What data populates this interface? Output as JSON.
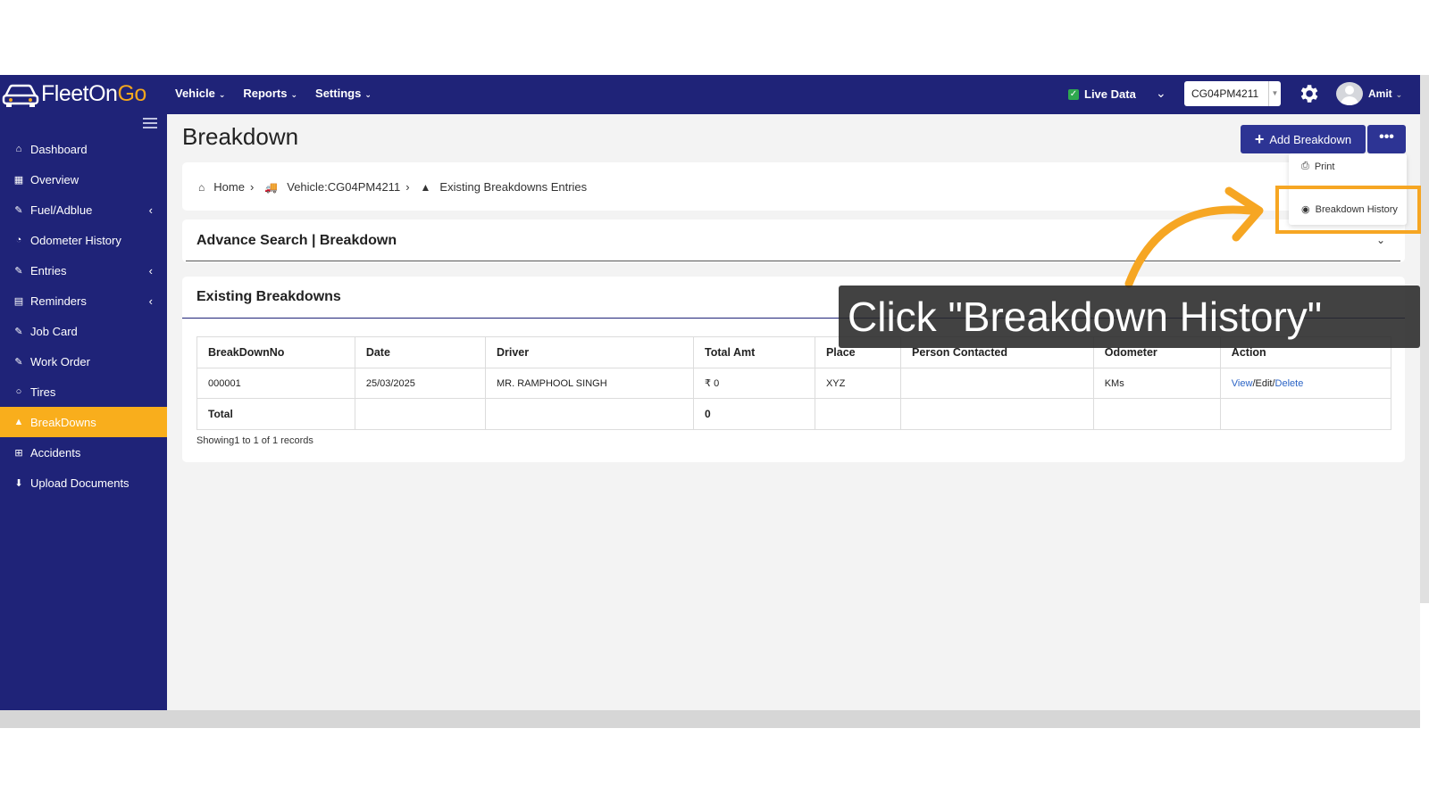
{
  "app": {
    "logo_fleet": "FleetOn",
    "logo_go": "Go",
    "nav": [
      {
        "label": "Vehicle"
      },
      {
        "label": "Reports"
      },
      {
        "label": "Settings"
      }
    ],
    "live_data_label": "Live Data",
    "vehicle_select": "CG04PM4211",
    "user_name": "Amit"
  },
  "sidebar": {
    "items": [
      {
        "label": "Dashboard",
        "icon": "home-icon",
        "glyph": "⌂",
        "top": 0
      },
      {
        "label": "Overview",
        "icon": "grid-icon",
        "glyph": "▦"
      },
      {
        "label": "Fuel/Adblue",
        "icon": "edit-icon",
        "glyph": "✎"
      },
      {
        "label": "Odometer History",
        "icon": "dashboard-icon",
        "glyph": "◔"
      },
      {
        "label": "Entries",
        "icon": "edit-icon",
        "glyph": "✎"
      },
      {
        "label": "Reminders",
        "icon": "calendar-icon",
        "glyph": "▤"
      },
      {
        "label": "Job Card",
        "icon": "edit-icon",
        "glyph": "✎"
      },
      {
        "label": "Work Order",
        "icon": "edit-icon",
        "glyph": "✎"
      },
      {
        "label": "Tires",
        "icon": "circle-icon",
        "glyph": "○"
      },
      {
        "label": "BreakDowns",
        "icon": "warning-icon",
        "glyph": "▲"
      },
      {
        "label": "Accidents",
        "icon": "plus-square-icon",
        "glyph": "⊞"
      },
      {
        "label": "Upload Documents",
        "icon": "download-icon",
        "glyph": "⬇"
      }
    ]
  },
  "page": {
    "title": "Breakdown",
    "add_button": "Add Breakdown",
    "more_button": "•••"
  },
  "dropdown": {
    "print": "Print",
    "breakdown_history": "Breakdown History"
  },
  "breadcrumb": {
    "home": "Home",
    "vehicle": "Vehicle:CG04PM4211",
    "current": "Existing Breakdowns Entries"
  },
  "advance_search": {
    "title": "Advance Search | Breakdown"
  },
  "existing": {
    "title": "Existing Breakdowns",
    "columns": [
      "BreakDownNo",
      "Date",
      "Driver",
      "Total Amt",
      "Place",
      "Person Contacted",
      "Odometer",
      "Action"
    ],
    "row": {
      "no": "000001",
      "date": "25/03/2025",
      "driver": "MR. RAMPHOOL SINGH",
      "total_amt": "₹ 0",
      "place": "XYZ",
      "person": "",
      "odometer": "KMs",
      "view": "View",
      "edit": "Edit",
      "delete": "Delete"
    },
    "total_label": "Total",
    "total_value": "0",
    "showing": "Showing1 to 1 of 1 records"
  },
  "overlay": {
    "instruction": "Click \"Breakdown History\"",
    "accent": "#f6a623"
  }
}
